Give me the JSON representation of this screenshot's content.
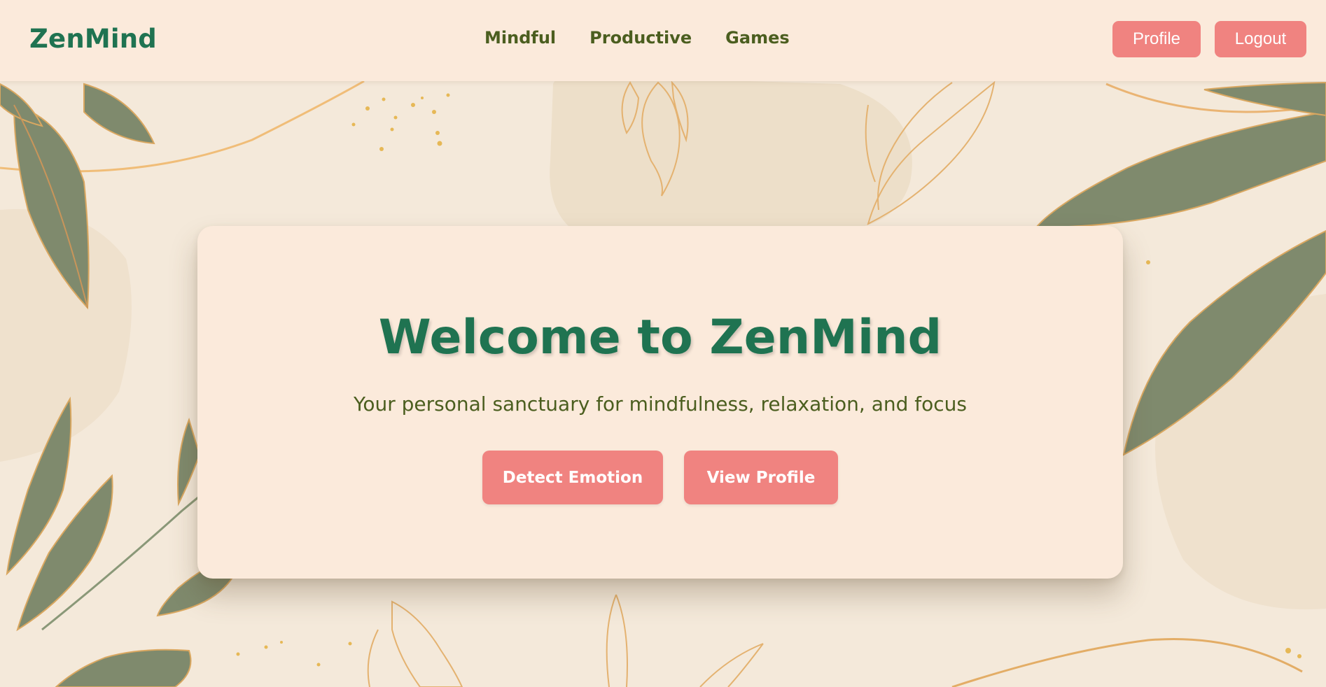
{
  "header": {
    "brand": "ZenMind",
    "nav": [
      {
        "label": "Mindful"
      },
      {
        "label": "Productive"
      },
      {
        "label": "Games"
      }
    ],
    "profile_label": "Profile",
    "logout_label": "Logout"
  },
  "hero": {
    "title": "Welcome to ZenMind",
    "subtitle": "Your personal sanctuary for mindfulness, relaxation, and focus",
    "detect_label": "Detect Emotion",
    "view_profile_label": "View Profile"
  },
  "colors": {
    "brand_green": "#1f7351",
    "nav_olive": "#4b5e1f",
    "button_coral": "#f08380",
    "header_bg": "#fbeadb",
    "page_bg": "#f4e9da",
    "leaf_green": "#7f8a6d",
    "gold_line": "#e9b86c"
  },
  "icons": [
    "leaf-decoration",
    "gold-line-decoration",
    "gold-dots-decoration"
  ]
}
